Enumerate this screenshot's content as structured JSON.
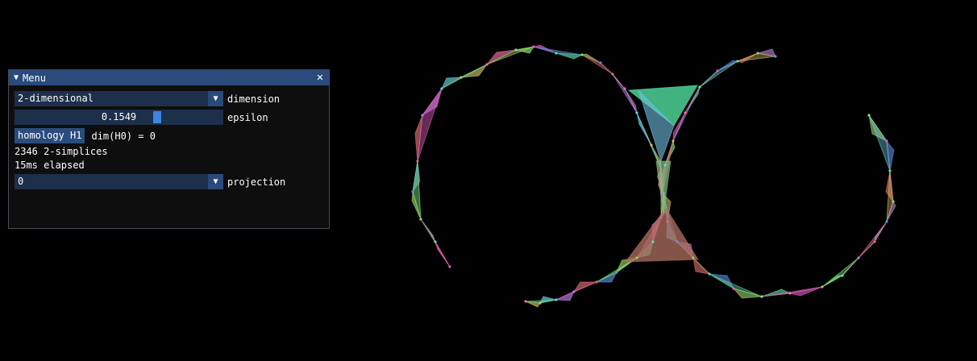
{
  "window": {
    "title": "Menu",
    "collapse_icon": "▼",
    "close_icon": "✕"
  },
  "dimension": {
    "value": "2-dimensional",
    "label": "dimension",
    "arrow": "▼"
  },
  "epsilon": {
    "value": "0.1549",
    "label": "epsilon",
    "fraction": 0.69
  },
  "homology": {
    "button_label": "homology H1",
    "result": "dim(H0) = 0"
  },
  "stats": {
    "simplices": "2346 2-simplices",
    "elapsed": "15ms elapsed"
  },
  "projection": {
    "value": "0",
    "label": "projection",
    "arrow": "▼"
  },
  "colors": {
    "window_bg": "#0f0f0f",
    "title_bg": "#294a7a",
    "frame_bg": "#1d2f4a",
    "accent": "#3d85e0"
  }
}
